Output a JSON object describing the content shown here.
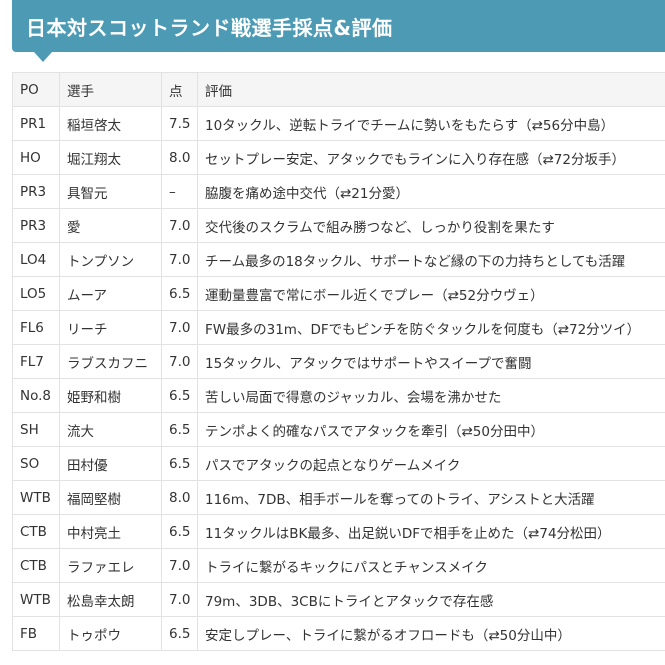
{
  "title": "日本対スコットランド戦選手採点&評価",
  "headers": {
    "po": "PO",
    "player": "選手",
    "score": "点",
    "review": "評価"
  },
  "rows": [
    {
      "po": "PR1",
      "player": "稲垣啓太",
      "score": "7.5",
      "review": "10タックル、逆転トライでチームに勢いをもたらす（⇄56分中島）"
    },
    {
      "po": "HO",
      "player": "堀江翔太",
      "score": "8.0",
      "review": "セットプレー安定、アタックでもラインに入り存在感（⇄72分坂手）"
    },
    {
      "po": "PR3",
      "player": "具智元",
      "score": "–",
      "review": "脇腹を痛め途中交代（⇄21分愛）"
    },
    {
      "po": "PR3",
      "player": "愛",
      "score": "7.0",
      "review": "交代後のスクラムで組み勝つなど、しっかり役割を果たす"
    },
    {
      "po": "LO4",
      "player": "トンプソン",
      "score": "7.0",
      "review": "チーム最多の18タックル、サポートなど縁の下の力持ちとしても活躍"
    },
    {
      "po": "LO5",
      "player": "ムーア",
      "score": "6.5",
      "review": "運動量豊富で常にボール近くでプレー（⇄52分ウヴェ）"
    },
    {
      "po": "FL6",
      "player": "リーチ",
      "score": "7.0",
      "review": "FW最多の31m、DFでもピンチを防ぐタックルを何度も（⇄72分ツイ）"
    },
    {
      "po": "FL7",
      "player": "ラブスカフニ",
      "score": "7.0",
      "review": "15タックル、アタックではサポートやスイープで奮闘"
    },
    {
      "po": "No.8",
      "player": "姫野和樹",
      "score": "6.5",
      "review": "苦しい局面で得意のジャッカル、会場を沸かせた"
    },
    {
      "po": "SH",
      "player": "流大",
      "score": "6.5",
      "review": "テンポよく的確なパスでアタックを牽引（⇄50分田中）"
    },
    {
      "po": "SO",
      "player": "田村優",
      "score": "6.5",
      "review": "パスでアタックの起点となりゲームメイク"
    },
    {
      "po": "WTB",
      "player": "福岡堅樹",
      "score": "8.0",
      "review": "116m、7DB、相手ボールを奪ってのトライ、アシストと大活躍"
    },
    {
      "po": "CTB",
      "player": "中村亮土",
      "score": "6.5",
      "review": "11タックルはBK最多、出足鋭いDFで相手を止めた（⇄74分松田）"
    },
    {
      "po": "CTB",
      "player": "ラファエレ",
      "score": "7.0",
      "review": "トライに繋がるキックにパスとチャンスメイク"
    },
    {
      "po": "WTB",
      "player": "松島幸太朗",
      "score": "7.0",
      "review": "79m、3DB、3CBにトライとアタックで存在感"
    },
    {
      "po": "FB",
      "player": "トゥポウ",
      "score": "6.5",
      "review": "安定しプレー、トライに繋がるオフロードも（⇄50分山中）"
    }
  ]
}
